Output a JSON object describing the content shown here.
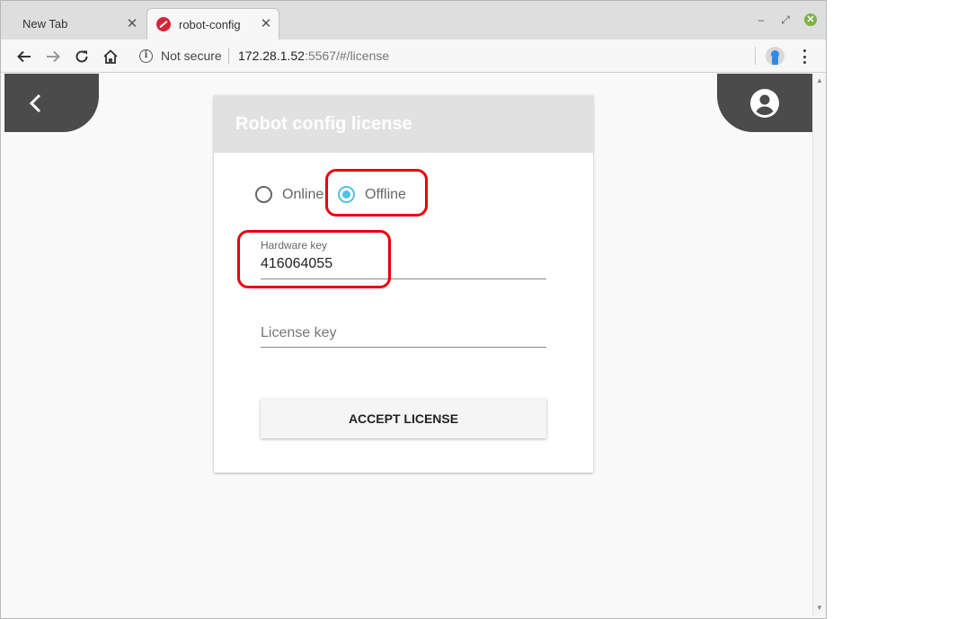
{
  "browser": {
    "tabs": [
      {
        "title": "New Tab",
        "active": false
      },
      {
        "title": "robot-config",
        "active": true
      }
    ],
    "toolbar": {
      "security_label": "Not secure",
      "url_host": "172.28.1.52",
      "url_rest": ":5567/#/license"
    },
    "colors": {
      "close_button": "#7cb342",
      "favicon": "#d6253a"
    }
  },
  "page": {
    "card": {
      "title": "Robot config license",
      "mode_options": [
        {
          "label": "Online",
          "selected": false
        },
        {
          "label": "Offline",
          "selected": true
        }
      ],
      "hardware_key": {
        "label": "Hardware key",
        "value": "416064055"
      },
      "license_key": {
        "placeholder": "License key",
        "value": ""
      },
      "accept_button": "ACCEPT LICENSE"
    },
    "colors": {
      "fab_background": "#4b4b4b",
      "radio_selected": "#4fc3e8",
      "header_background": "#e1e1e1",
      "highlight": "#e8000b"
    }
  }
}
